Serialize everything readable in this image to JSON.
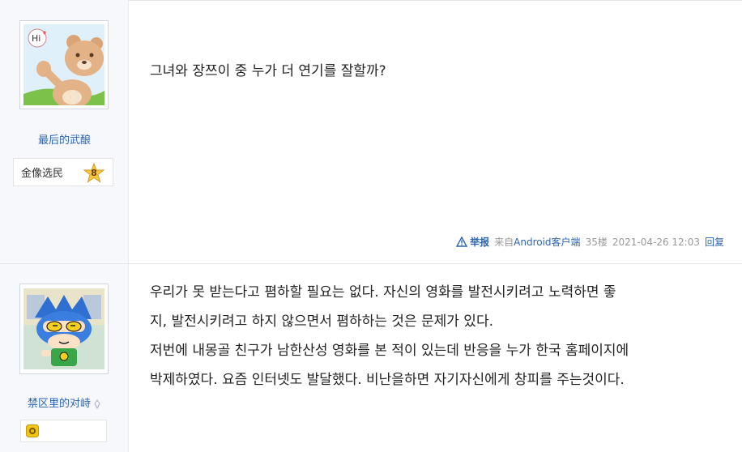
{
  "posts": [
    {
      "username": "最后的武酿",
      "badge_label": "金像选民",
      "level": "8",
      "content_lines": [
        "그녀와 장쯔이 중 누가 더 연기를 잘할까?"
      ],
      "report_label": "举报",
      "client_prefix": "来自",
      "client_name": "Android客户端",
      "floor": "35楼",
      "timestamp": "2021-04-26 12:03",
      "reply_label": "回复"
    },
    {
      "username": "禁区里的对峙",
      "content_lines": [
        "우리가 못 받는다고 폄하할 필요는 없다. 자신의 영화를 발전시키려고 노력하면 좋",
        "지, 발전시키려고 하지 않으면서 폄하하는 것은 문제가 있다.",
        "저번에 내몽골 친구가 남한산성 영화를 본 적이 있는데 반응을 누가 한국 홈페이지에",
        "박제하였다. 요즘 인터넷도 발달했다. 비난을하면 자기자신에게 창피를 주는것이다."
      ]
    }
  ],
  "colors": {
    "link": "#2d64b3",
    "sidebar_bg": "#f6f8fb",
    "meta": "#999999"
  },
  "icons": {
    "avatar1": "bear-avatar-icon",
    "avatar2": "cartoon-boy-avatar-icon",
    "report": "warning-triangle-icon",
    "level": "star-level-icon",
    "badge2": "yellow-badge-icon"
  }
}
